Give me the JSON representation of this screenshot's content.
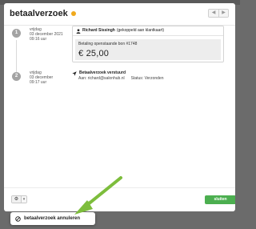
{
  "modal": {
    "title": "betaalverzoek",
    "status_dot_color": "#f0a91c",
    "nav": {
      "prev_icon": "chevron-left-icon",
      "next_icon": "chevron-right-icon"
    }
  },
  "timeline": [
    {
      "step": "1",
      "day": "vrijdag",
      "date": "03 december 2021",
      "time": "09:16 uur",
      "card": {
        "icon": "user-icon",
        "name": "Richard Sissingh",
        "note": "(gekoppeld aan klantkaart)",
        "subtitle": "Betaling openstaande bon #1748",
        "amount": "€ 25,00"
      }
    },
    {
      "step": "2",
      "day": "vrijdag",
      "date": "03 december",
      "time": "09:17 uur",
      "event": {
        "icon": "send-icon",
        "title": "Betaalverzoek verstuurd",
        "to": "Aan: richard@salonhub.nl",
        "status": "Status: Verzonden"
      }
    }
  ],
  "footer": {
    "gear_icon": "gear-icon",
    "caret_icon": "chevron-down-icon",
    "close_label": "sluiten",
    "close_color": "#4caf50"
  },
  "popup": {
    "icon": "cancel-payment-icon",
    "label": "betaalverzoek annuleren"
  },
  "annotation": {
    "arrow_color": "#7dbd3c"
  }
}
